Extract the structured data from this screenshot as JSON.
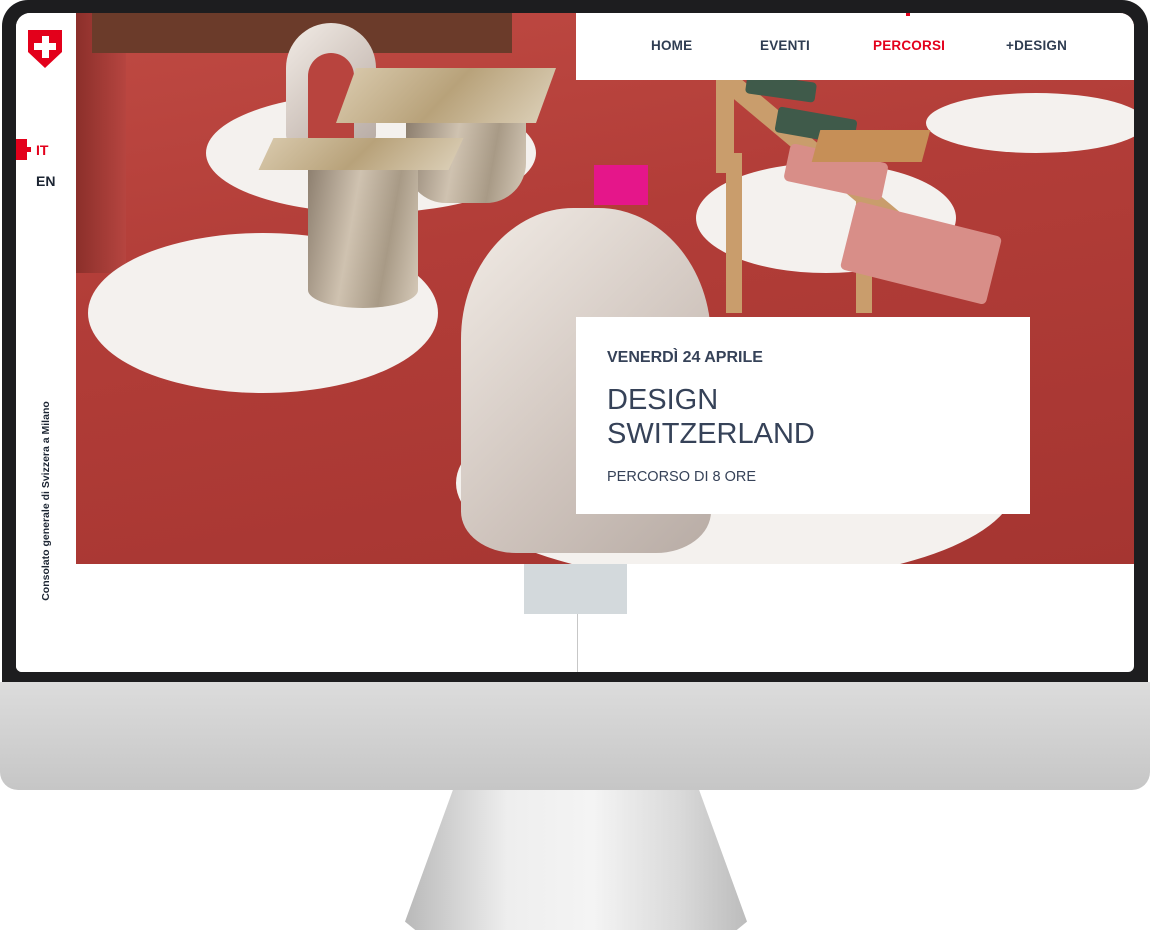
{
  "site": {
    "logo_icon": "swiss-cross-icon",
    "brand_color": "#e3001b",
    "text_color": "#364258"
  },
  "languages": [
    {
      "label": "IT",
      "active": true
    },
    {
      "label": "EN",
      "active": false
    }
  ],
  "sidebar": {
    "consulate_label": "Consolato generale di Svizzera a Milano"
  },
  "nav": {
    "items": [
      {
        "label": "HOME",
        "active": false
      },
      {
        "label": "EVENTI",
        "active": false
      },
      {
        "label": "PERCORSI",
        "active": true
      },
      {
        "label": "+DESIGN",
        "active": false
      }
    ]
  },
  "hero": {
    "date": "VENERDÌ 24 APRILE",
    "title_line1": "DESIGN",
    "title_line2": "SWITZERLAND",
    "subtitle": "PERCORSO DI 8 ORE"
  }
}
